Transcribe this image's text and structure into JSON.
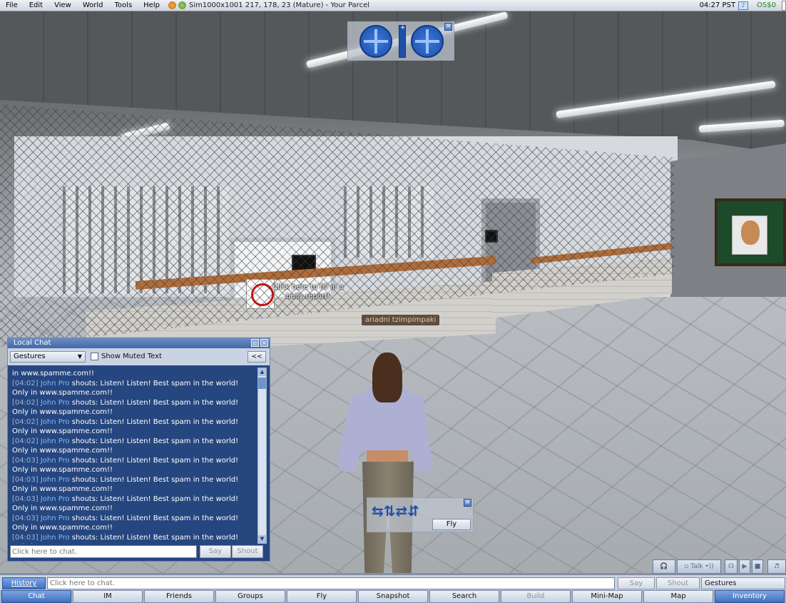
{
  "menubar": {
    "items": [
      "File",
      "Edit",
      "View",
      "World",
      "Tools",
      "Help"
    ],
    "location": "Sim1000x1001 217, 178, 23 (Mature) - Your Parcel",
    "time": "04:27 PST",
    "balance": "OS$0"
  },
  "scene": {
    "hover_text": "Click here to fill in a bully report!",
    "avatar_name": "ariadni tzimpimpaki"
  },
  "local_chat": {
    "title": "Local Chat",
    "gestures_label": "Gestures",
    "show_muted_label": "Show Muted Text",
    "collapse_label": "<<",
    "first_line": "in www.spamme.com!!",
    "messages": [
      {
        "time": "[04:02]",
        "name": "John Pro",
        "text": " shouts: Listen! Listen! Best spam in the world! Only in www.spamme.com!!"
      },
      {
        "time": "[04:02]",
        "name": "John Pro",
        "text": " shouts: Listen! Listen! Best spam in the world! Only in www.spamme.com!!"
      },
      {
        "time": "[04:02]",
        "name": "John Pro",
        "text": " shouts: Listen! Listen! Best spam in the world! Only in www.spamme.com!!"
      },
      {
        "time": "[04:02]",
        "name": "John Pro",
        "text": " shouts: Listen! Listen! Best spam in the world! Only in www.spamme.com!!"
      },
      {
        "time": "[04:03]",
        "name": "John Pro",
        "text": " shouts: Listen! Listen! Best spam in the world! Only in www.spamme.com!!"
      },
      {
        "time": "[04:03]",
        "name": "John Pro",
        "text": " shouts: Listen! Listen! Best spam in the world! Only in www.spamme.com!!"
      },
      {
        "time": "[04:03]",
        "name": "John Pro",
        "text": " shouts: Listen! Listen! Best spam in the world! Only in www.spamme.com!!"
      },
      {
        "time": "[04:03]",
        "name": "John Pro",
        "text": " shouts: Listen! Listen! Best spam in the world! Only in www.spamme.com!!"
      },
      {
        "time": "[04:03]",
        "name": "John Pro",
        "text": " shouts: Listen! Listen! Best spam in the world! Only in www.spamme.com!!"
      }
    ],
    "input_placeholder": "Click here to chat.",
    "say_label": "Say",
    "shout_label": "Shout"
  },
  "movement": {
    "fly_label": "Fly"
  },
  "voice": {
    "talk_label": "Talk"
  },
  "chatbar": {
    "history_label": "History",
    "input_placeholder": "Click here to chat.",
    "say_label": "Say",
    "shout_label": "Shout",
    "gestures_label": "Gestures"
  },
  "toolbar": {
    "buttons": [
      "Chat",
      "IM",
      "Friends",
      "Groups",
      "Fly",
      "Snapshot",
      "Search",
      "Build",
      "Mini-Map",
      "Map",
      "Inventory"
    ]
  },
  "colors": {
    "accent": "#3f6fbd",
    "chat_bg": "#26467f",
    "name_color": "#7fb8ff",
    "balance": "#1c8a1c"
  }
}
